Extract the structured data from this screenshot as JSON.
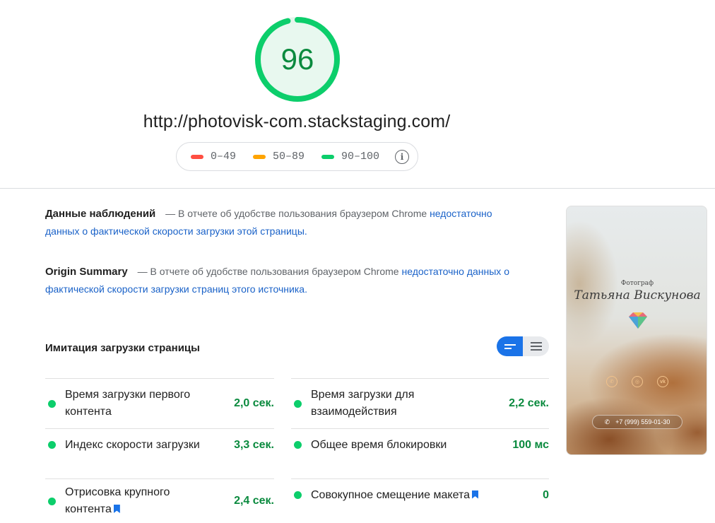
{
  "score": {
    "value": "96",
    "fraction": 0.96,
    "color": "#0cce6b"
  },
  "url": "http://photovisk-com.stackstaging.com/",
  "legend": [
    {
      "label": "0–49",
      "color": "#ff4e42"
    },
    {
      "label": "50–89",
      "color": "#ffa400"
    },
    {
      "label": "90–100",
      "color": "#0cce6b"
    }
  ],
  "legend_info_icon": "info-icon",
  "field_data": {
    "title": "Данные наблюдений",
    "desc": "— В отчете об удобстве пользования браузером Chrome",
    "link": "недостаточно данных о фактической скорости загрузки этой страницы",
    "tail": "."
  },
  "origin_summary": {
    "title": "Origin Summary",
    "desc": "— В отчете об удобстве пользования браузером Chrome",
    "link": "недостаточно данных о фактической скорости загрузки страниц этого источника",
    "tail": "."
  },
  "lab": {
    "title": "Имитация загрузки страницы",
    "metrics": [
      {
        "label": "Время загрузки первого контента",
        "value": "2,0 сек."
      },
      {
        "label": "Время загрузки для взаимодействия",
        "value": "2,2 сек."
      },
      {
        "label": "Индекс скорости загрузки",
        "value": "3,3 сек."
      },
      {
        "label": "Общее время блокировки",
        "value": "100 мс"
      },
      {
        "label": "Отрисовка крупного контента",
        "value": "2,4 сек."
      },
      {
        "label": "Совокупное смещение макета",
        "value": "0"
      }
    ]
  },
  "thumbnail": {
    "caption": "Фотограф",
    "name": "Татьяна Вискунова",
    "icons": [
      "whatsapp-icon",
      "instagram-icon",
      "vk-icon"
    ],
    "phone": "+7 (999) 559-01-30"
  },
  "colors": {
    "pass": "#0cce6b",
    "pass_text": "#0a8a3e",
    "link": "#1a62c8",
    "accent": "#1a73e8"
  }
}
